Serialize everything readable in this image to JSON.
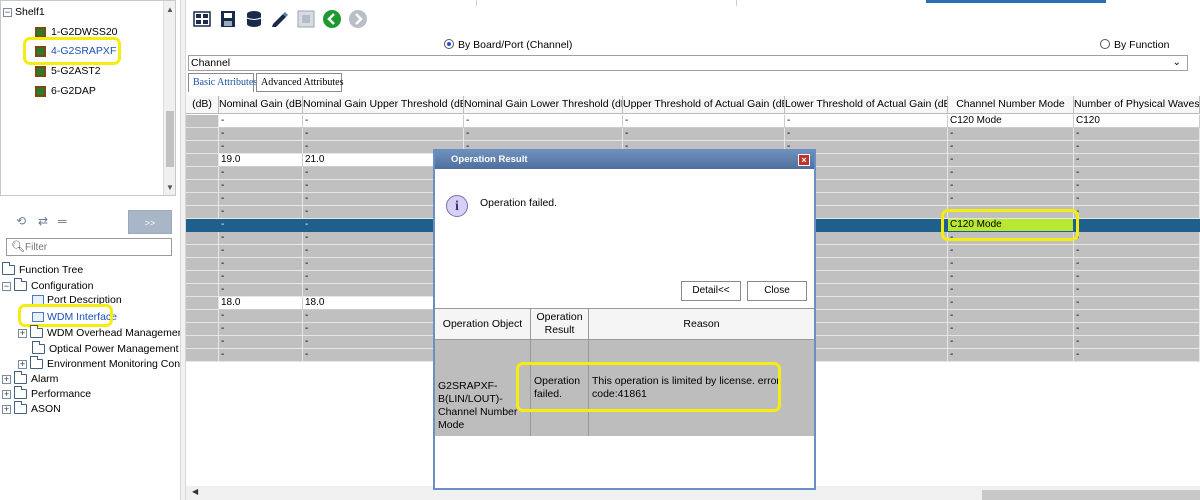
{
  "ne_tree": {
    "root_label": "Shelf1",
    "boards": [
      {
        "label": "1-G2DWSS20"
      },
      {
        "label": "4-G2SRAPXF"
      },
      {
        "label": "5-G2AST2"
      },
      {
        "label": "6-G2DAP"
      }
    ]
  },
  "left_toolbar": {
    "expand_label": ">>"
  },
  "filter": {
    "placeholder": "Filter"
  },
  "function_tree": {
    "root_label": "Function Tree",
    "configuration_label": "Configuration",
    "configuration_children": [
      {
        "label": "Port Description"
      },
      {
        "label": "WDM Interface"
      },
      {
        "label": "WDM Overhead Management"
      },
      {
        "label": "Optical Power Management"
      },
      {
        "label": "Environment Monitoring Configuration"
      }
    ],
    "top_items": [
      {
        "label": "Alarm"
      },
      {
        "label": "Performance"
      },
      {
        "label": "ASON"
      }
    ]
  },
  "query_mode": {
    "by_board_port": "By Board/Port (Channel)",
    "by_function": "By Function",
    "selected": "by_board_port"
  },
  "object_select": {
    "value": "Channel"
  },
  "tabs": [
    {
      "label": "Basic Attributes",
      "active": true
    },
    {
      "label": "Advanced Attributes",
      "active": false
    }
  ],
  "grid": {
    "headers": [
      "(dB)",
      "Nominal Gain (dB)",
      "Nominal Gain Upper Threshold (dB)",
      "Nominal Gain Lower Threshold (dB)",
      "Upper Threshold of Actual Gain (dB)",
      "Lower Threshold of Actual Gain (dB)",
      "Channel Number Mode",
      "Number of Physical Waves"
    ],
    "rows": [
      [
        "",
        "-",
        "-",
        "-",
        "-",
        "-",
        "C120 Mode",
        "C120"
      ],
      [
        "",
        "-",
        "-",
        "-",
        "-",
        "-",
        "-",
        "-"
      ],
      [
        "",
        "-",
        "-",
        "-",
        "-",
        "-",
        "-",
        "-"
      ],
      [
        "",
        "19.0",
        "21.0",
        "",
        "",
        "",
        "-",
        "-"
      ],
      [
        "",
        "-",
        "-",
        "",
        "",
        "",
        "-",
        "-"
      ],
      [
        "",
        "-",
        "-",
        "",
        "",
        "",
        "-",
        "-"
      ],
      [
        "",
        "-",
        "-",
        "",
        "",
        "",
        "-",
        "-"
      ],
      [
        "",
        "-",
        "-",
        "",
        "",
        "",
        "-",
        "-"
      ],
      [
        "",
        "-",
        "-",
        "",
        "",
        "",
        "C120 Mode",
        "-"
      ],
      [
        "",
        "-",
        "-",
        "",
        "",
        "",
        "-",
        "-"
      ],
      [
        "",
        "-",
        "-",
        "",
        "",
        "",
        "-",
        "-"
      ],
      [
        "",
        "-",
        "-",
        "",
        "",
        "",
        "-",
        "-"
      ],
      [
        "",
        "-",
        "-",
        "",
        "",
        "",
        "-",
        "-"
      ],
      [
        "",
        "-",
        "-",
        "",
        "",
        "",
        "-",
        "-"
      ],
      [
        "",
        "18.0",
        "18.0",
        "",
        "",
        "",
        "-",
        "-"
      ],
      [
        "",
        "-",
        "-",
        "",
        "",
        "",
        "-",
        "-"
      ],
      [
        "",
        "-",
        "-",
        "",
        "",
        "",
        "-",
        "-"
      ],
      [
        "",
        "-",
        "-",
        "",
        "",
        "",
        "-",
        "-"
      ],
      [
        "",
        "-",
        "-",
        "",
        "",
        "",
        "-",
        "-"
      ]
    ]
  },
  "dialog": {
    "title": "Operation Result",
    "message": "Operation failed.",
    "detail_button": "Detail<<",
    "close_button": "Close",
    "table_headers": [
      "Operation Object",
      "Operation Result",
      "Reason"
    ],
    "row": {
      "object": "G2SRAPXF-B(LIN/LOUT)-Channel Number Mode",
      "result": "Operation failed.",
      "reason": "This operation is limited by license. error code:41861"
    }
  },
  "colors": {
    "selected_row": "#1e5f8e",
    "highlight": "#f5ec12",
    "selected_cell": "#b8e830",
    "dialog_title": "#5a7bab"
  }
}
